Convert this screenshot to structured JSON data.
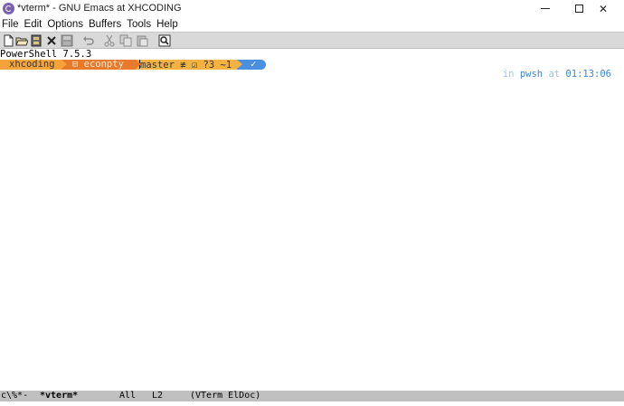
{
  "window": {
    "title": "*vterm* - GNU Emacs at XHCODING",
    "minimize_glyph": "",
    "close_glyph": "✕"
  },
  "menubar": {
    "items": [
      "File",
      "Edit",
      "Options",
      "Buffers",
      "Tools",
      "Help"
    ]
  },
  "toolbar": {
    "buttons": [
      "new-file",
      "open-file",
      "open-directory",
      "close-buffer",
      "save",
      "undo",
      "cut",
      "copy",
      "paste",
      "search"
    ]
  },
  "terminal": {
    "banner": "PowerShell 7.5.3",
    "prompt": {
      "user": "xhcoding",
      "path": "⊟ econpty",
      "git": "master ≢ ☑ ?3 ~1",
      "status": "✓"
    },
    "right_prompt": {
      "in_label": "in",
      "shell": "pwsh",
      "at_label": "at",
      "time": "01:13:06"
    }
  },
  "modeline": {
    "status": "c\\%*-",
    "buffer": "*vterm*",
    "position": "All",
    "line": "L2",
    "modes": "(VTerm ElDoc)"
  },
  "colors": {
    "user_segment": "#f2a33a",
    "path_segment": "#e87a2c",
    "git_segment": "#f2b342",
    "status_segment": "#4a90e2",
    "toolbar_bg": "#d9d9d9",
    "modeline_bg": "#c0c0c0"
  }
}
